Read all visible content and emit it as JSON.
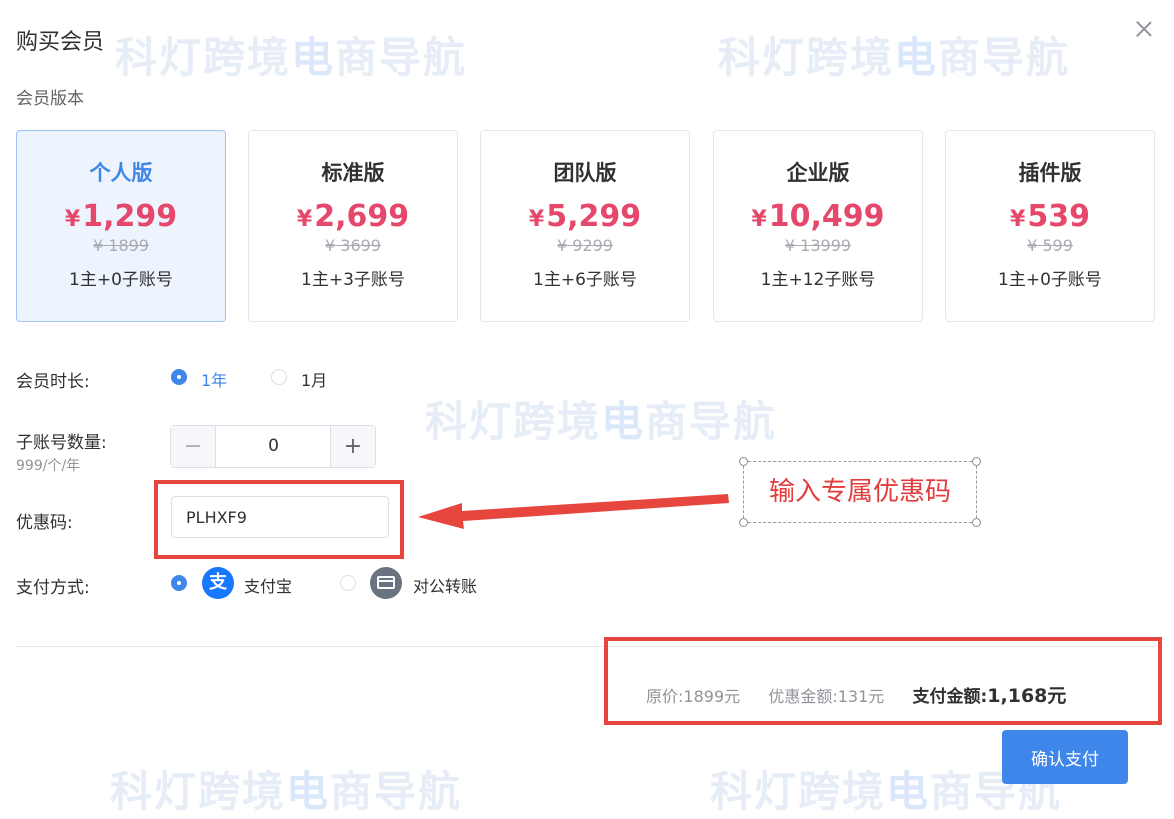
{
  "watermark": {
    "text_a": "科灯跨境",
    "text_b": "电",
    "text_c": "商导航"
  },
  "dialog": {
    "title": "购买会员",
    "close_icon": "close-icon"
  },
  "plan_section_label": "会员版本",
  "plans": [
    {
      "name": "个人版",
      "currency": "¥",
      "price": "1,299",
      "original": "¥ 1899",
      "accounts": "1主+0子账号",
      "selected": true
    },
    {
      "name": "标准版",
      "currency": "¥",
      "price": "2,699",
      "original": "¥ 3699",
      "accounts": "1主+3子账号",
      "selected": false
    },
    {
      "name": "团队版",
      "currency": "¥",
      "price": "5,299",
      "original": "¥ 9299",
      "accounts": "1主+6子账号",
      "selected": false
    },
    {
      "name": "企业版",
      "currency": "¥",
      "price": "10,499",
      "original": "¥ 13999",
      "accounts": "1主+12子账号",
      "selected": false
    },
    {
      "name": "插件版",
      "currency": "¥",
      "price": "539",
      "original": "¥ 599",
      "accounts": "1主+0子账号",
      "selected": false
    }
  ],
  "duration": {
    "label": "会员时长:",
    "options": [
      {
        "label": "1年",
        "selected": true
      },
      {
        "label": "1月",
        "selected": false
      }
    ]
  },
  "sub_accounts": {
    "label": "子账号数量:",
    "sublabel": "999/个/年",
    "value": "0",
    "minus": "−",
    "plus": "+"
  },
  "coupon": {
    "label": "优惠码:",
    "value": "PLHXF9"
  },
  "annotation": {
    "text": "输入专属优惠码"
  },
  "payment": {
    "label": "支付方式:",
    "options": [
      {
        "label": "支付宝",
        "icon": "alipay-icon",
        "icon_glyph": "支",
        "selected": true
      },
      {
        "label": "对公转账",
        "icon": "bank-card-icon",
        "selected": false
      }
    ]
  },
  "summary": {
    "original_label": "原价:",
    "original_value": "1899元",
    "discount_label": "优惠金额:",
    "discount_value": "131元",
    "total_label": "支付金额:",
    "total_value": "1,168元"
  },
  "confirm_label": "确认支付",
  "colors": {
    "accent": "#3f86ea",
    "price": "#e6486b",
    "annotation": "#e7463f"
  }
}
